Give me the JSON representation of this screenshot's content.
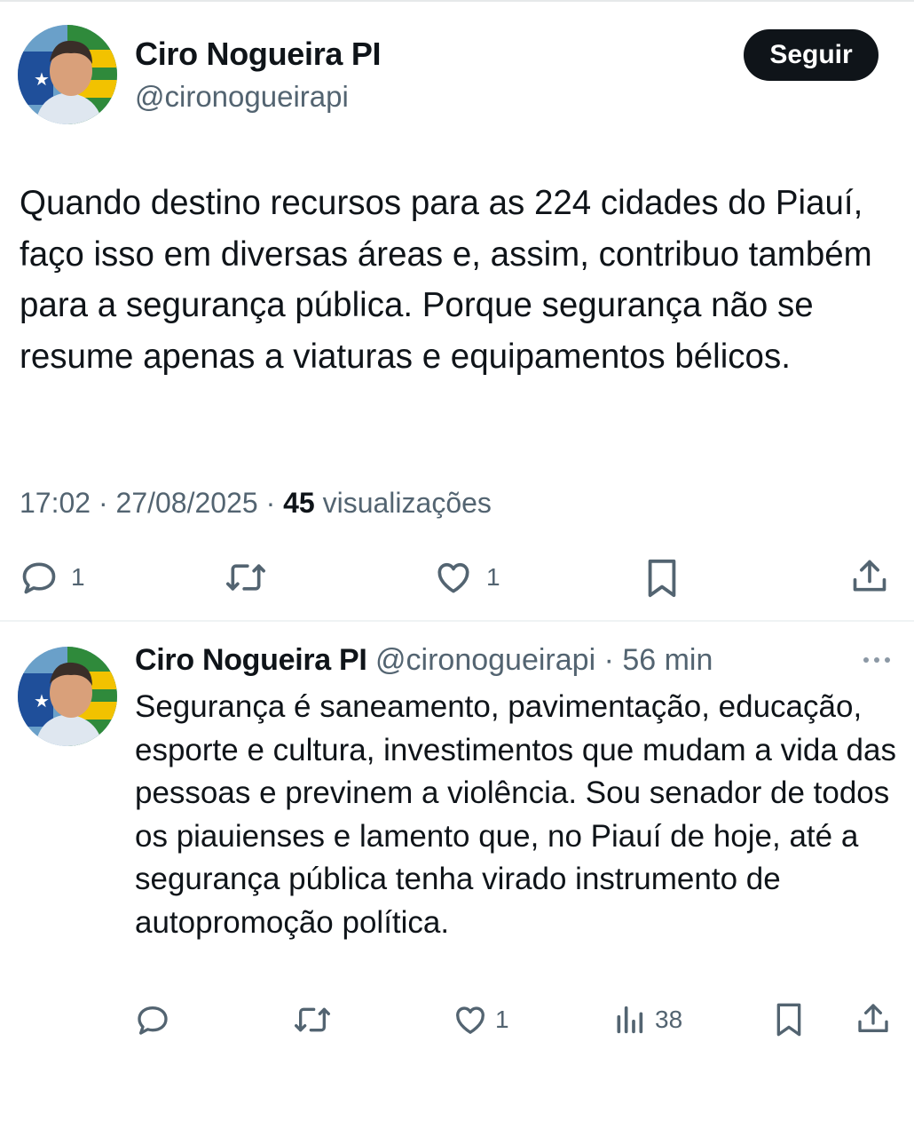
{
  "tweet1": {
    "author_name": "Ciro Nogueira PI",
    "author_handle": "@cironogueirapi",
    "follow_label": "Seguir",
    "text": "Quando destino recursos para as 224 cidades do Piauí, faço isso em diversas áreas e, assim, contribuo também para a segurança pública. Porque segurança não se resume apenas a viaturas e equipamentos bélicos.",
    "time": "17:02",
    "date": "27/08/2025",
    "views_count": "45",
    "views_label": "visualizações",
    "separator": "·",
    "actions": {
      "reply_count": "1",
      "like_count": "1"
    }
  },
  "tweet2": {
    "author_name": "Ciro Nogueira PI",
    "author_handle": "@cironogueirapi",
    "separator": "·",
    "time_ago": "56 min",
    "text": "Segurança é saneamento, pavimentação, educação, esporte e cultura, investimentos que mudam a vida das pessoas e previnem a violência. Sou senador de todos os piauienses e lamento que, no Piauí de hoje, até a segurança pública tenha virado instrumento de autopromoção política.",
    "actions": {
      "like_count": "1",
      "views_count": "38"
    }
  },
  "icons": [
    "avatar",
    "reply-icon",
    "retweet-icon",
    "like-icon",
    "bookmark-icon",
    "share-icon",
    "views-icon",
    "more-icon"
  ],
  "colors": {
    "text": "#0f1419",
    "secondary": "#536471",
    "follow_button_bg": "#0f1419",
    "divider": "#eff3f4"
  }
}
